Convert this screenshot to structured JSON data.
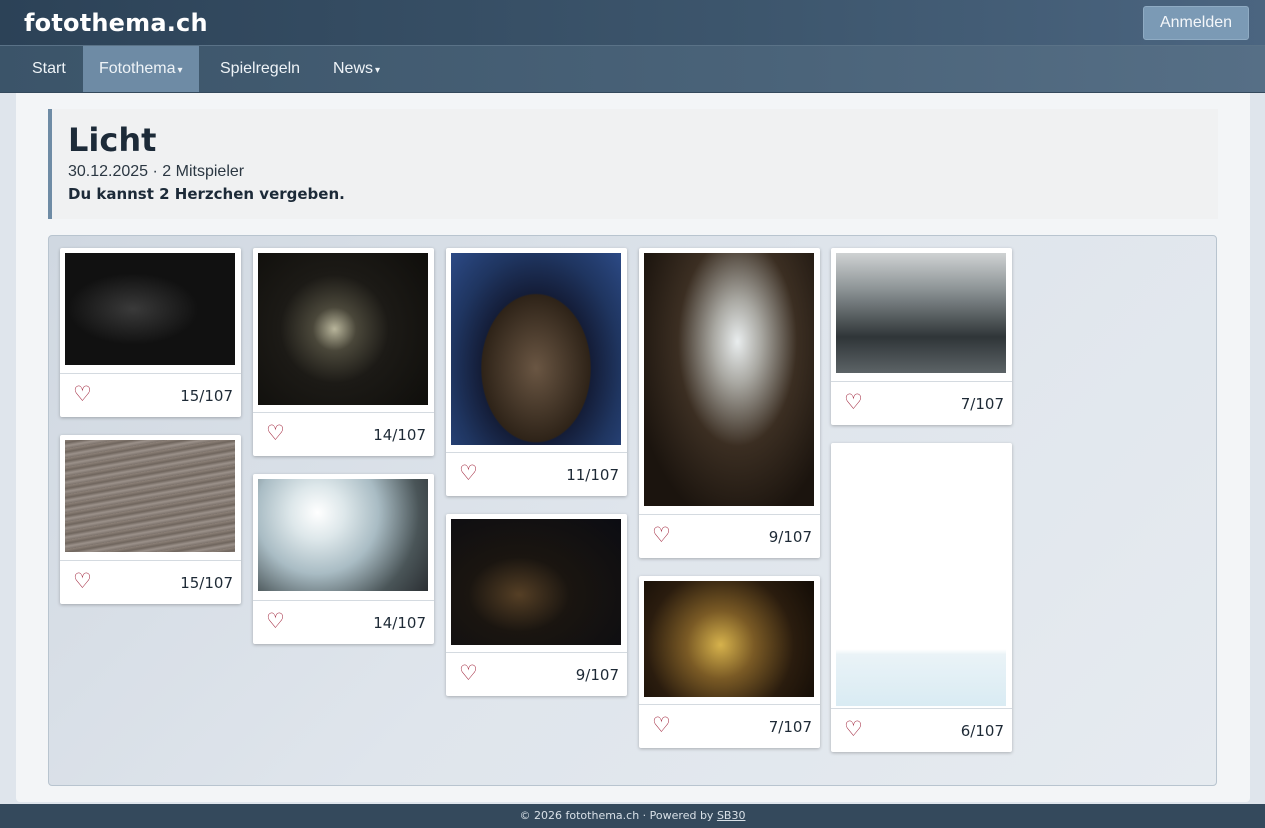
{
  "header": {
    "brand": "fotothema.ch",
    "login_label": "Anmelden"
  },
  "nav": {
    "items": [
      {
        "label": "Start",
        "caret": ""
      },
      {
        "label": "Fotothema",
        "caret": "▾"
      },
      {
        "label": "Spielregeln",
        "caret": ""
      },
      {
        "label": "News",
        "caret": "▾"
      }
    ],
    "active": "Fotothema"
  },
  "theme": {
    "title": "Licht",
    "meta": "30.12.2025 · 2 Mitspieler",
    "hint": "Du kannst 2 Herzchen vergeben."
  },
  "photos": [
    {
      "count": "15/107",
      "icon": "heart-outline-icon"
    },
    {
      "count": "15/107",
      "icon": "heart-outline-icon"
    },
    {
      "count": "14/107",
      "icon": "heart-outline-icon"
    },
    {
      "count": "14/107",
      "icon": "heart-outline-icon"
    },
    {
      "count": "11/107",
      "icon": "heart-outline-icon"
    },
    {
      "count": "9/107",
      "icon": "heart-outline-icon"
    },
    {
      "count": "9/107",
      "icon": "heart-outline-icon"
    },
    {
      "count": "7/107",
      "icon": "heart-outline-icon"
    },
    {
      "count": "7/107",
      "icon": "heart-outline-icon"
    },
    {
      "count": "6/107",
      "icon": "heart-outline-icon"
    }
  ],
  "footer": {
    "text": "© 2026 fotothema.ch · Powered by ",
    "link": "SB30"
  },
  "colors": {
    "accent": "#6e8ba5",
    "heart": "#a0233a",
    "topbar": "#2c4257"
  }
}
